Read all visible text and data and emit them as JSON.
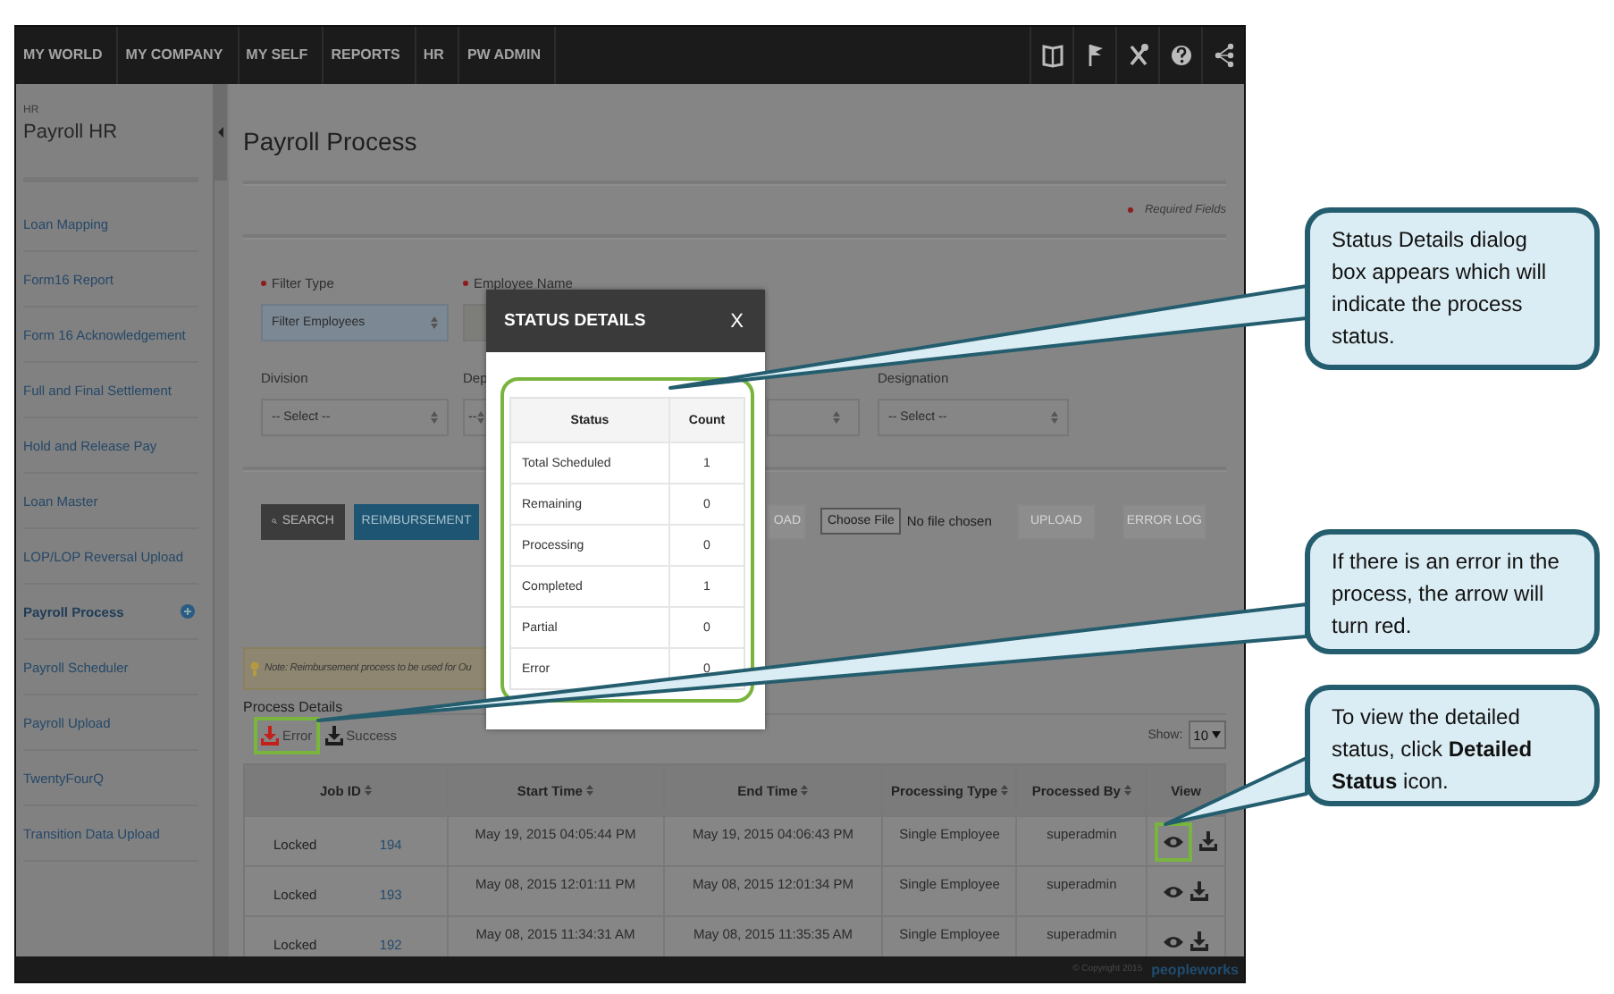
{
  "top_nav": {
    "items": [
      "MY WORLD",
      "MY COMPANY",
      "MY SELF",
      "REPORTS",
      "HR",
      "PW ADMIN"
    ]
  },
  "sidebar": {
    "module": "HR",
    "title": "Payroll HR",
    "items": [
      {
        "label": "Loan Mapping",
        "selected": false
      },
      {
        "label": "Form16 Report",
        "selected": false
      },
      {
        "label": "Form 16 Acknowledgement",
        "selected": false
      },
      {
        "label": "Full and Final Settlement",
        "selected": false
      },
      {
        "label": "Hold and Release Pay",
        "selected": false
      },
      {
        "label": "Loan Master",
        "selected": false
      },
      {
        "label": "LOP/LOP Reversal Upload",
        "selected": false
      },
      {
        "label": "Payroll Process",
        "selected": true
      },
      {
        "label": "Payroll Scheduler",
        "selected": false
      },
      {
        "label": "Payroll Upload",
        "selected": false
      },
      {
        "label": "TwentyFourQ",
        "selected": false
      },
      {
        "label": "Transition Data Upload",
        "selected": false
      }
    ]
  },
  "page": {
    "title": "Payroll Process",
    "required_note": "Required Fields"
  },
  "form": {
    "rows": [
      [
        {
          "label": "Filter Type",
          "required": true,
          "kind": "select",
          "value": "Filter Employees",
          "focused": true
        },
        {
          "label": "Employee Name",
          "required": true,
          "kind": "text",
          "focused": false
        }
      ],
      [
        {
          "label": "Division",
          "required": false,
          "kind": "select",
          "value": "-- Select --",
          "focused": false
        },
        {
          "label": "Dep",
          "required": false,
          "kind": "select",
          "value": "--",
          "focused": false
        },
        {
          "kind": "select",
          "focused": false
        },
        {
          "label": "Designation",
          "required": false,
          "kind": "select",
          "value": "-- Select --",
          "focused": false
        }
      ]
    ]
  },
  "actions": [
    {
      "kind": "search",
      "label": "SEARCH"
    },
    {
      "kind": "primary",
      "label": "REIMBURSEMENT"
    },
    {
      "kind": "disabled",
      "label": "OAD"
    },
    {
      "kind": "file",
      "label": "Choose File",
      "status": "No file chosen"
    },
    {
      "kind": "disabled",
      "label": "UPLOAD"
    },
    {
      "kind": "disabled",
      "label": "ERROR LOG"
    }
  ],
  "note": "Note: Reimbursement process to be used for Ou",
  "process_details": {
    "title": "Process Details",
    "downloads": [
      {
        "label": "Error",
        "color": "#c41f1a",
        "highlighted": true
      },
      {
        "label": "Success",
        "color": "#1c1c1c",
        "highlighted": false
      }
    ],
    "show_label": "Show:",
    "page_size": "10"
  },
  "table": {
    "columns": [
      "Job ID",
      "Start Time",
      "End Time",
      "Processing Type",
      "Processed By",
      "View"
    ],
    "rows": [
      {
        "status": "Locked",
        "job_id": "194",
        "start_time": "May 19, 2015 04:05:44 PM",
        "end_time": "May 19, 2015 04:06:43 PM",
        "processing_type": "Single Employee",
        "processed_by": "superadmin",
        "view_highlighted": true
      },
      {
        "status": "Locked",
        "job_id": "193",
        "start_time": "May 08, 2015 12:01:11 PM",
        "end_time": "May 08, 2015 12:01:34 PM",
        "processing_type": "Single Employee",
        "processed_by": "superadmin",
        "view_highlighted": false
      },
      {
        "status": "Locked",
        "job_id": "192",
        "start_time": "May 08, 2015 11:34:31 AM",
        "end_time": "May 08, 2015 11:35:35 AM",
        "processing_type": "Single Employee",
        "processed_by": "superadmin",
        "view_highlighted": false
      }
    ]
  },
  "dialog": {
    "title": "STATUS DETAILS",
    "close": "X",
    "highlighted": true,
    "columns": [
      "Status",
      "Count"
    ],
    "rows": [
      {
        "status": "Total Scheduled",
        "count": "1"
      },
      {
        "status": "Remaining",
        "count": "0"
      },
      {
        "status": "Processing",
        "count": "0"
      },
      {
        "status": "Completed",
        "count": "1"
      },
      {
        "status": "Partial",
        "count": "0"
      },
      {
        "status": "Error",
        "count": "0"
      }
    ]
  },
  "footer": {
    "copyright": "© Copyright 2015",
    "brand": "peopleworks"
  },
  "callouts": [
    {
      "text": "Status Details  dialog box appears which will indicate the process status."
    },
    {
      "text": "If there is an error in the process, the arrow will turn red."
    },
    {
      "text": "To view the detailed status, click **Detailed Status** icon."
    }
  ]
}
